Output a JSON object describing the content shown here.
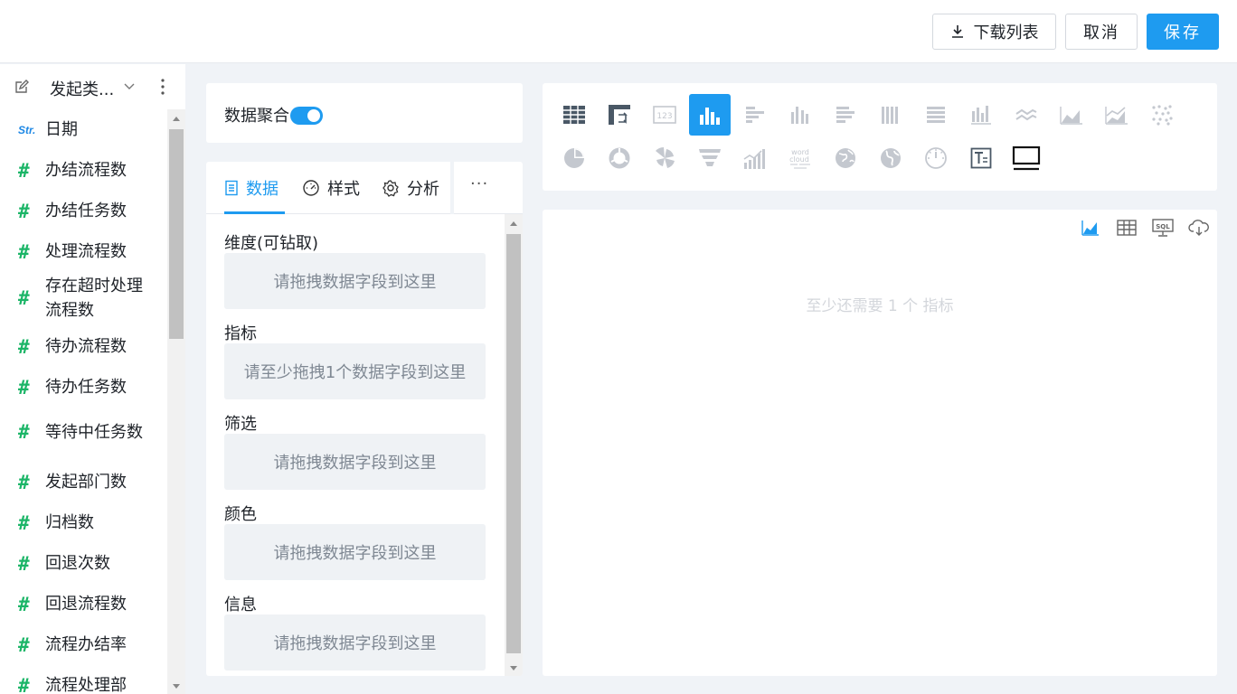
{
  "header": {
    "download_label": "下载列表",
    "cancel_label": "取消",
    "save_label": "保存"
  },
  "sidebar": {
    "title": "发起类...",
    "fields": [
      {
        "type": "str",
        "icon_text": "Str.",
        "label": "日期"
      },
      {
        "type": "num",
        "icon_text": "#",
        "label": "办结流程数"
      },
      {
        "type": "num",
        "icon_text": "#",
        "label": "办结任务数"
      },
      {
        "type": "num",
        "icon_text": "#",
        "label": "处理流程数"
      },
      {
        "type": "num",
        "icon_text": "#",
        "label": "存在超时处理流程数"
      },
      {
        "type": "num",
        "icon_text": "#",
        "label": "待办流程数"
      },
      {
        "type": "num",
        "icon_text": "#",
        "label": "待办任务数"
      },
      {
        "type": "num",
        "icon_text": "#",
        "label": "等待中任务数"
      },
      {
        "type": "num",
        "icon_text": "#",
        "label": "发起部门数"
      },
      {
        "type": "num",
        "icon_text": "#",
        "label": "归档数"
      },
      {
        "type": "num",
        "icon_text": "#",
        "label": "回退次数"
      },
      {
        "type": "num",
        "icon_text": "#",
        "label": "回退流程数"
      },
      {
        "type": "num",
        "icon_text": "#",
        "label": "流程办结率"
      },
      {
        "type": "num",
        "icon_text": "#",
        "label": "流程处理部"
      }
    ]
  },
  "aggregation": {
    "label": "数据聚合",
    "enabled": true
  },
  "config": {
    "tabs": [
      {
        "label": "数据",
        "icon": "data-icon",
        "active": true
      },
      {
        "label": "样式",
        "icon": "gauge-icon",
        "active": false
      },
      {
        "label": "分析",
        "icon": "gear-icon",
        "active": false
      }
    ],
    "more_label": "···",
    "sections": [
      {
        "label": "维度(可钻取)",
        "placeholder": "请拖拽数据字段到这里"
      },
      {
        "label": "指标",
        "placeholder": "请至少拖拽1个数据字段到这里"
      },
      {
        "label": "筛选",
        "placeholder": "请拖拽数据字段到这里"
      },
      {
        "label": "颜色",
        "placeholder": "请拖拽数据字段到这里"
      },
      {
        "label": "信息",
        "placeholder": "请拖拽数据字段到这里"
      }
    ]
  },
  "chart_types": {
    "selected": "bar-chart-icon",
    "row1": [
      "table-icon",
      "pivot-table-icon",
      "number-card-icon",
      "bar-chart-icon",
      "horizontal-bar-icon",
      "grouped-bar-icon",
      "stacked-horizontal-bar-icon",
      "stacked-bar-icon",
      "percent-horizontal-bar-icon",
      "percent-bar-icon",
      "line-chart-icon",
      "area-chart-icon",
      "stacked-area-icon",
      "scatter-icon"
    ],
    "row2": [
      "pie-chart-icon",
      "donut-chart-icon",
      "rose-chart-icon",
      "funnel-chart-icon",
      "combo-chart-icon",
      "word-cloud-icon",
      "world-map-icon",
      "map-icon",
      "gauge-chart-icon",
      "text-card-icon",
      "screen-icon"
    ],
    "word_cloud_text": [
      "word",
      "cloud"
    ]
  },
  "preview": {
    "message": "至少还需要 1 个 指标",
    "toolbar": [
      "area-chart-view-icon",
      "table-view-icon",
      "sql-view-icon",
      "cloud-download-icon"
    ],
    "sql_text": "SQL"
  },
  "colors": {
    "accent": "#1e9bf0",
    "number_field": "#1bb567",
    "string_field": "#1e88e5",
    "inactive_icon": "#c4c8cf"
  }
}
